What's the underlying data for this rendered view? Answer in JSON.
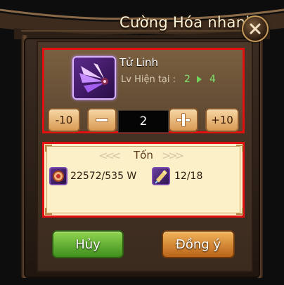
{
  "dialog": {
    "title": "Cường Hóa  nhanh",
    "close_icon": "close-icon"
  },
  "item": {
    "name": "Tử Linh",
    "icon": "purple-wings-icon",
    "level_label": "Lv  Hiện tại :",
    "level_current": "2",
    "level_next": "4"
  },
  "quantity": {
    "minus10_label": "-10",
    "minus_icon": "minus-icon",
    "value": "2",
    "plus_icon": "plus-icon",
    "plus10_label": "+10"
  },
  "cost": {
    "title": "Tốn",
    "resources": [
      {
        "icon": "gold-coin-icon",
        "amount": "22572/535 W"
      },
      {
        "icon": "feather-crystal-icon",
        "amount": "12/18"
      }
    ]
  },
  "actions": {
    "cancel_label": "Hủy",
    "confirm_label": "Đồng ý"
  },
  "colors": {
    "highlight_border": "#e01010",
    "level_value": "#7fe36b",
    "cancel_button": "#5fae2f",
    "confirm_button": "#d6862f"
  }
}
